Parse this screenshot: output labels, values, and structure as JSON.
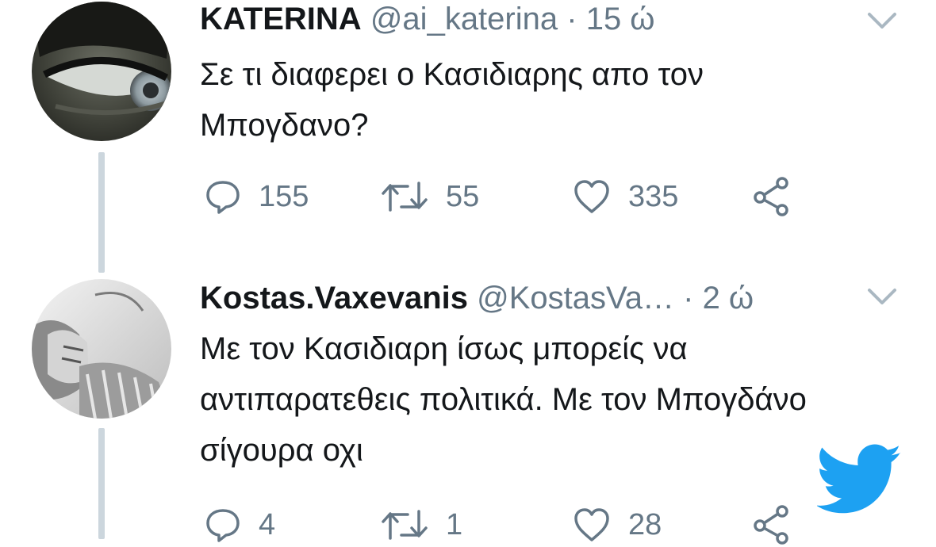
{
  "tweets": [
    {
      "name": "KATERINA",
      "handle": "@ai_katerina",
      "separator": "·",
      "time": "15 ώ",
      "text": "Σε τι διαφερει ο Κασιδιαρης απο τον Μπογδανο?",
      "replies": "155",
      "retweets": "55",
      "likes": "335"
    },
    {
      "name": "Kostas.Vaxevanis",
      "handle": "@KostasVa…",
      "separator": "·",
      "time": "2 ώ",
      "text": "Με τον Κασιδιαρη ίσως μπορείς να αντιπαρατεθεις πολιτικά. Με τον Μπογδάνο σίγουρα οχι",
      "replies": "4",
      "retweets": "1",
      "likes": "28"
    }
  ],
  "colors": {
    "text": "#14171a",
    "secondary": "#657786",
    "thread_line": "#ccd6dd",
    "brand": "#1da1f2"
  },
  "icons": [
    "chevron-down-icon",
    "reply-icon",
    "retweet-icon",
    "heart-icon",
    "share-icon",
    "twitter-bird-icon"
  ]
}
